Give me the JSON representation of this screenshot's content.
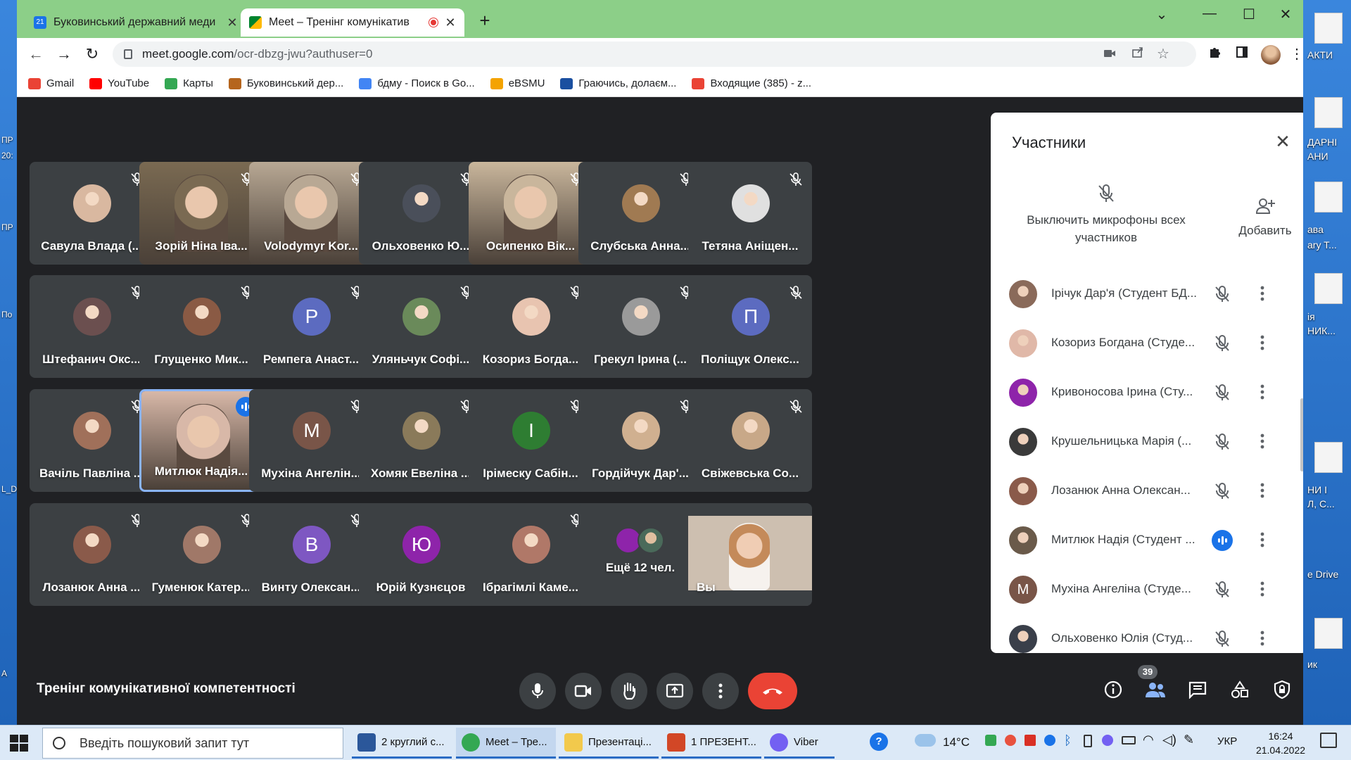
{
  "desktop": {
    "right_labels": [
      "АКТИ",
      "ДАРНІ",
      "АНИ",
      "ава",
      "ary T...",
      "ія",
      "НИК...",
      "НИ І",
      "Л, С...",
      "e Drive",
      "ик"
    ],
    "left_labels": [
      "ПР",
      "20:",
      "ПР",
      "По",
      "L_D",
      "А"
    ]
  },
  "browser": {
    "tabs": [
      {
        "title": "Буковинський державний меди",
        "favicon_color": "#1a73e8",
        "active": false
      },
      {
        "title": "Meet – Тренінг комунікатив",
        "favicon_color": "#34a853",
        "active": true,
        "recording": true
      }
    ],
    "new_tab": "+",
    "window_controls": [
      "⌄",
      "—",
      "☐",
      "✕"
    ],
    "url_domain": "meet.google.com",
    "url_path": "/ocr-dbzg-jwu?authuser=0",
    "bookmarks": [
      {
        "label": "Gmail",
        "color": "#ea4335"
      },
      {
        "label": "YouTube",
        "color": "#ff0000"
      },
      {
        "label": "Карты",
        "color": "#34a853"
      },
      {
        "label": "Буковинський дер...",
        "color": "#b5651d"
      },
      {
        "label": "бдму - Поиск в Go...",
        "color": "#4285f4"
      },
      {
        "label": "eBSMU",
        "color": "#f4a300"
      },
      {
        "label": "Граючись, долаєм...",
        "color": "#1a4fa0"
      },
      {
        "label": "Входящие (385) - z...",
        "color": "#ea4335"
      }
    ]
  },
  "meet": {
    "tiles": [
      {
        "name": "Савула Влада (...",
        "kind": "avatar",
        "bg": "#d9b8a0",
        "muted": true
      },
      {
        "name": "Зорій Ніна Іва...",
        "kind": "video",
        "bg": "#7a6a52",
        "muted": true
      },
      {
        "name": "Volodymyr Kor...",
        "kind": "video",
        "bg": "#b8a894",
        "muted": true
      },
      {
        "name": "Ольховенко Ю...",
        "kind": "avatar",
        "bg": "#4a4f5a",
        "muted": true
      },
      {
        "name": "Осипенко Вік...",
        "kind": "video",
        "bg": "#c9b69c",
        "muted": true
      },
      {
        "name": "Слубська Анна...",
        "kind": "avatar",
        "bg": "#a07a52",
        "muted": true
      },
      {
        "name": "Тетяна Аніщен...",
        "kind": "avatar",
        "bg": "#e0e0e0",
        "muted": true
      },
      {
        "name": "Штефанич Окс...",
        "kind": "avatar",
        "bg": "#6b4f4f",
        "muted": true
      },
      {
        "name": "Глущенко Мик...",
        "kind": "avatar",
        "bg": "#8a5a44",
        "muted": true
      },
      {
        "name": "Ремпега Анаст...",
        "kind": "letter",
        "letter": "P",
        "bg": "#5c6bc0",
        "muted": true
      },
      {
        "name": "Уляньчук Софі...",
        "kind": "avatar",
        "bg": "#6a8a5a",
        "muted": true
      },
      {
        "name": "Козориз Богда...",
        "kind": "avatar",
        "bg": "#e8c4b0",
        "muted": true
      },
      {
        "name": "Грекул Ірина (...",
        "kind": "avatar",
        "bg": "#9a9a9a",
        "muted": true
      },
      {
        "name": "Поліщук Олекс...",
        "kind": "letter",
        "letter": "П",
        "bg": "#5c6bc0",
        "muted": true
      },
      {
        "name": "Вачіль Павліна ...",
        "kind": "avatar",
        "bg": "#a0705a",
        "muted": true
      },
      {
        "name": "Митлюк Надія...",
        "kind": "video",
        "bg": "#d8b8a8",
        "muted": false,
        "speaking": true
      },
      {
        "name": "Мухіна Ангелін...",
        "kind": "letter",
        "letter": "M",
        "bg": "#795548",
        "muted": true
      },
      {
        "name": "Хомяк Евеліна ...",
        "kind": "avatar",
        "bg": "#8a7a5a",
        "muted": true
      },
      {
        "name": "Ірімеску Сабін...",
        "kind": "letter",
        "letter": "I",
        "bg": "#2e7d32",
        "muted": true
      },
      {
        "name": "Гордійчук Дар'...",
        "kind": "avatar",
        "bg": "#d0b090",
        "muted": true
      },
      {
        "name": "Свіжевська Со...",
        "kind": "avatar",
        "bg": "#c8a888",
        "muted": true
      },
      {
        "name": "Лозанюк Анна ...",
        "kind": "avatar",
        "bg": "#8a5a4a",
        "muted": true
      },
      {
        "name": "Гуменюк Катер...",
        "kind": "avatar",
        "bg": "#a07868",
        "muted": true
      },
      {
        "name": "Винту Олексан...",
        "kind": "letter",
        "letter": "B",
        "bg": "#7e57c2",
        "muted": true
      },
      {
        "name": "Юрій Кузнєцов",
        "kind": "letter",
        "letter": "Ю",
        "bg": "#8e24aa",
        "muted": false
      },
      {
        "name": "Ібрагімлі Каме...",
        "kind": "avatar",
        "bg": "#b07868",
        "muted": true
      },
      {
        "name": "Ещё 12 чел.",
        "kind": "more",
        "muted": false
      },
      {
        "name": "Вы",
        "kind": "self",
        "bg": "#cdbfb0",
        "muted": false
      }
    ],
    "meeting_title": "Тренінг комунікативної компетентності",
    "participant_count": "39"
  },
  "panel": {
    "title": "Участники",
    "mute_all_label": "Выключить микрофоны всех участников",
    "add_label": "Добавить",
    "participants": [
      {
        "name": "Ірічук Дар'я (Студент БД...",
        "kind": "avatar",
        "bg": "#8a6a5a",
        "speaking": false
      },
      {
        "name": "Козориз Богдана (Студе...",
        "kind": "avatar",
        "bg": "#e0b8a8",
        "speaking": false
      },
      {
        "name": "Кривоносова Ірина (Сту...",
        "kind": "avatar",
        "bg": "#8e24aa",
        "speaking": false
      },
      {
        "name": "Крушельницька Марія (...",
        "kind": "avatar",
        "bg": "#3a3a3a",
        "speaking": false
      },
      {
        "name": "Лозанюк Анна Олексан...",
        "kind": "avatar",
        "bg": "#8a5a4a",
        "speaking": false
      },
      {
        "name": "Митлюк Надія (Студент ...",
        "kind": "avatar",
        "bg": "#6a5a4a",
        "speaking": true
      },
      {
        "name": "Мухіна Ангеліна (Студе...",
        "kind": "letter",
        "letter": "M",
        "speaking": false
      },
      {
        "name": "Ольховенко Юлія (Студ...",
        "kind": "avatar",
        "bg": "#3a3f4a",
        "speaking": false
      }
    ]
  },
  "taskbar": {
    "search_placeholder": "Введіть пошуковий запит тут",
    "apps": [
      {
        "label": "2 круглий с...",
        "color": "#2b579a",
        "active": false
      },
      {
        "label": "Meet – Тре...",
        "color": "#34a853",
        "active": true
      },
      {
        "label": "Презентаці...",
        "color": "#f2c94c",
        "active": false
      },
      {
        "label": "1 ПРЕЗЕНТ...",
        "color": "#d24726",
        "active": false
      },
      {
        "label": "Viber",
        "color": "#7360f2",
        "active": false
      }
    ],
    "weather": "14°C",
    "language": "УКР",
    "time": "16:24",
    "date": "21.04.2022"
  }
}
